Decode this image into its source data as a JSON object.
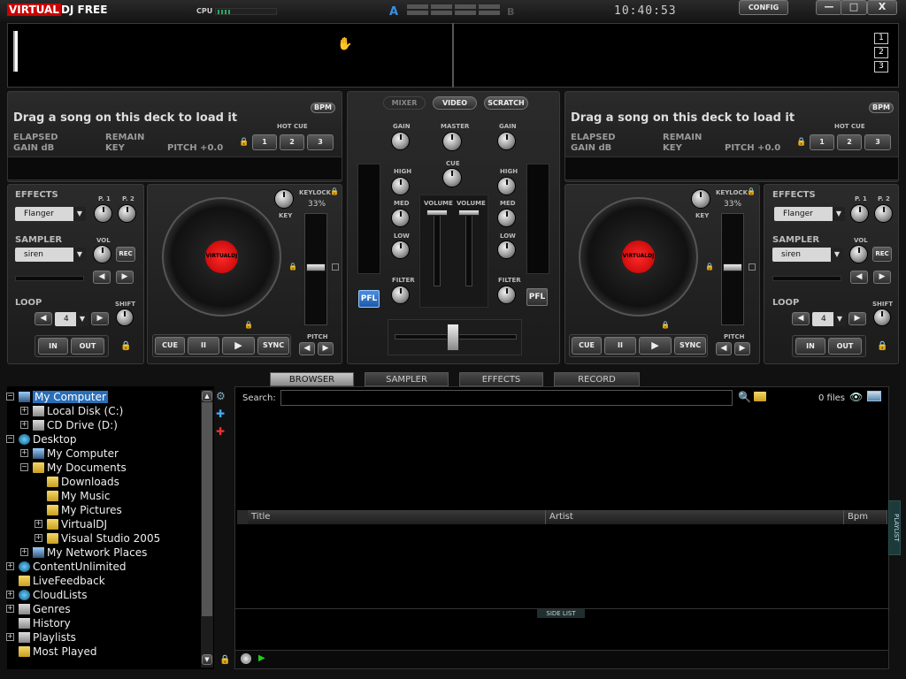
{
  "app": {
    "logo_a": "VIRTUAL",
    "logo_b": "DJ FREE",
    "cpu_label": "CPU",
    "clock": "10:40:53",
    "config_label": "CONFIG",
    "min_label": "—",
    "max_label": "□",
    "close_label": "X",
    "mix_a": "A",
    "mix_b": "B"
  },
  "waveform": {
    "zoom": [
      "1",
      "2",
      "3"
    ]
  },
  "deck_left": {
    "title": "Drag a song on this deck to load it",
    "bpm": "BPM",
    "elapsed": "ELAPSED",
    "remain": "REMAIN",
    "gain": "GAIN dB",
    "key": "KEY",
    "pitch": "PITCH +0.0",
    "hot_cue": "HOT CUE",
    "hot_cues": [
      "1",
      "2",
      "3"
    ],
    "effects_label": "EFFECTS",
    "effect": "Flanger",
    "p1": "P. 1",
    "p2": "P. 2",
    "sampler_label": "SAMPLER",
    "sample": "siren",
    "vol": "VOL",
    "rec": "REC",
    "loop_label": "LOOP",
    "loop_value": "4",
    "shift": "SHIFT",
    "in": "IN",
    "out": "OUT",
    "keylock": "KEYLOCK",
    "keylock_pct": "33%",
    "key_knob": "KEY",
    "pitch_label": "PITCH",
    "cue": "CUE",
    "pause": "II",
    "play": "▶",
    "sync": "SYNC",
    "platter_label": "VIRTUALDJ"
  },
  "deck_right": {
    "title": "Drag a song on this deck to load it",
    "bpm": "BPM",
    "elapsed": "ELAPSED",
    "remain": "REMAIN",
    "gain": "GAIN dB",
    "key": "KEY",
    "pitch": "PITCH +0.0",
    "hot_cue": "HOT CUE",
    "hot_cues": [
      "1",
      "2",
      "3"
    ],
    "effects_label": "EFFECTS",
    "effect": "Flanger",
    "p1": "P. 1",
    "p2": "P. 2",
    "sampler_label": "SAMPLER",
    "sample": "siren",
    "vol": "VOL",
    "rec": "REC",
    "loop_label": "LOOP",
    "loop_value": "4",
    "shift": "SHIFT",
    "in": "IN",
    "out": "OUT",
    "keylock": "KEYLOCK",
    "keylock_pct": "33%",
    "key_knob": "KEY",
    "pitch_label": "PITCH",
    "cue": "CUE",
    "pause": "II",
    "play": "▶",
    "sync": "SYNC",
    "platter_label": "VIRTUALDJ"
  },
  "mixer": {
    "tabs": [
      "MIXER",
      "VIDEO",
      "SCRATCH"
    ],
    "gain": "GAIN",
    "master": "MASTER",
    "cue": "CUE",
    "high": "HIGH",
    "med": "MED",
    "low": "LOW",
    "volume": "VOLUME",
    "filter": "FILTER",
    "pfl": "PFL"
  },
  "browser": {
    "tabs": [
      "BROWSER",
      "SAMPLER",
      "EFFECTS",
      "RECORD"
    ],
    "search_label": "Search:",
    "files_count": "0 files",
    "columns": [
      "Title",
      "Artist",
      "Bpm"
    ],
    "side_list": "SIDE LIST",
    "playlist": "PLAYLIST",
    "tree": [
      {
        "label": "My Computer",
        "pm": "−",
        "icon": "comp"
      },
      {
        "label": "Local Disk (C:)",
        "pm": "+",
        "icon": "drive"
      },
      {
        "label": "CD Drive (D:)",
        "pm": "+",
        "icon": "drive"
      },
      {
        "label": "Desktop",
        "pm": "−",
        "icon": "globe"
      },
      {
        "label": "My Computer",
        "pm": "+",
        "icon": "comp"
      },
      {
        "label": "My Documents",
        "pm": "−",
        "icon": "fold"
      },
      {
        "label": "Downloads",
        "pm": "",
        "icon": "fold"
      },
      {
        "label": "My Music",
        "pm": "",
        "icon": "fold"
      },
      {
        "label": "My Pictures",
        "pm": "",
        "icon": "fold"
      },
      {
        "label": "VirtualDJ",
        "pm": "+",
        "icon": "fold"
      },
      {
        "label": "Visual Studio 2005",
        "pm": "+",
        "icon": "fold"
      },
      {
        "label": "My Network Places",
        "pm": "+",
        "icon": "comp"
      },
      {
        "label": "ContentUnlimited",
        "pm": "+",
        "icon": "globe"
      },
      {
        "label": "LiveFeedback",
        "pm": "",
        "icon": "fold"
      },
      {
        "label": "CloudLists",
        "pm": "+",
        "icon": "globe"
      },
      {
        "label": "Genres",
        "pm": "+",
        "icon": "drive"
      },
      {
        "label": "History",
        "pm": "",
        "icon": "drive"
      },
      {
        "label": "Playlists",
        "pm": "+",
        "icon": "drive"
      },
      {
        "label": "Most Played",
        "pm": "",
        "icon": "fold"
      }
    ]
  }
}
